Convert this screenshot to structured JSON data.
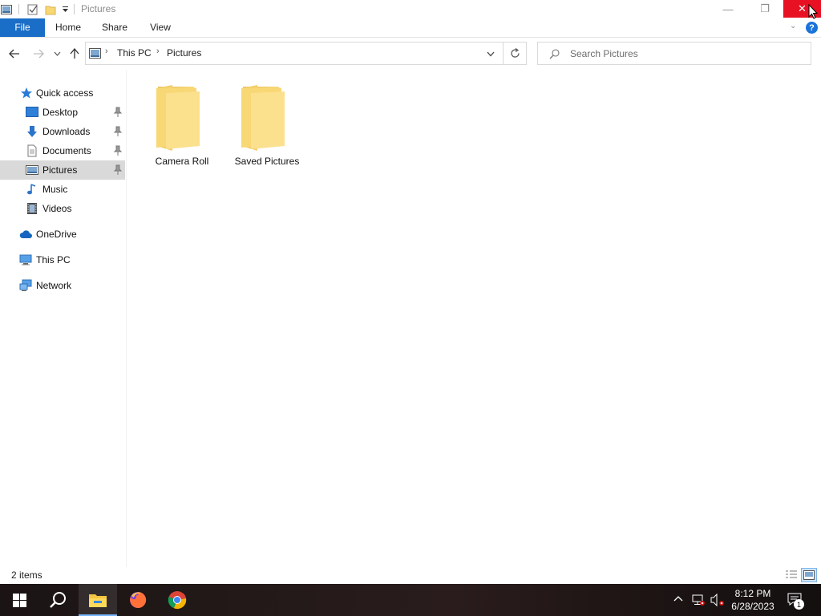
{
  "window": {
    "title": "Pictures",
    "minimize_glyph": "—",
    "restore_glyph": "❐",
    "close_glyph": "✕"
  },
  "ribbon": {
    "tabs": [
      {
        "label": "File"
      },
      {
        "label": "Home"
      },
      {
        "label": "Share"
      },
      {
        "label": "View"
      }
    ],
    "help_glyph": "?",
    "expand_glyph": "⌄"
  },
  "navigation": {
    "breadcrumb": [
      "This PC",
      "Pictures"
    ],
    "breadcrumb_separator": "›",
    "search_placeholder": "Search Pictures"
  },
  "sidebar": {
    "quick_access": "Quick access",
    "items": [
      {
        "label": "Desktop",
        "icon": "desktop-icon",
        "pinned": true
      },
      {
        "label": "Downloads",
        "icon": "downloads-icon",
        "pinned": true
      },
      {
        "label": "Documents",
        "icon": "documents-icon",
        "pinned": true
      },
      {
        "label": "Pictures",
        "icon": "pictures-icon",
        "pinned": true,
        "selected": true
      },
      {
        "label": "Music",
        "icon": "music-icon",
        "pinned": false
      },
      {
        "label": "Videos",
        "icon": "videos-icon",
        "pinned": false
      }
    ],
    "onedrive": "OneDrive",
    "this_pc": "This PC",
    "network": "Network"
  },
  "content": {
    "folders": [
      {
        "label": "Camera Roll"
      },
      {
        "label": "Saved Pictures"
      }
    ]
  },
  "status": {
    "item_count": "2 items"
  },
  "taskbar": {
    "time": "8:12 PM",
    "date": "6/28/2023",
    "notification_count": "1"
  },
  "colors": {
    "accent": "#1a6ec7",
    "close_red": "#e81123",
    "folder_yellow": "#f8d775",
    "selection": "#d9d9d9"
  }
}
